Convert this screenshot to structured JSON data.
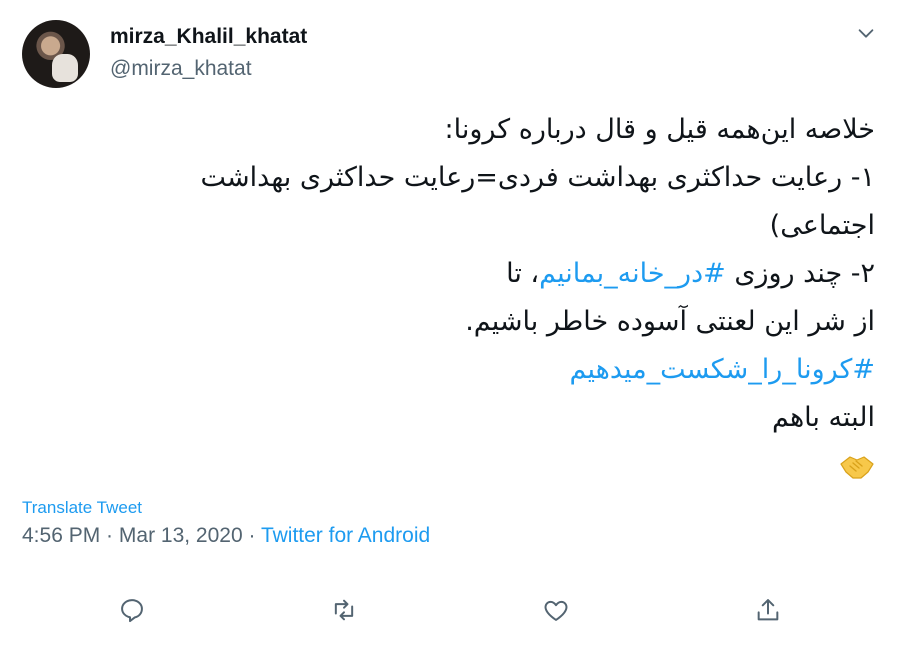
{
  "user": {
    "display_name": "mirza_Khalil_khatat",
    "handle": "@mirza_khatat"
  },
  "tweet": {
    "lines": [
      "خلاصه این‌همه قیل و قال درباره کرونا:",
      "۱- رعایت حداکثری بهداشت فردی=رعایت حداکثری بهداشت",
      "اجتماعی)"
    ],
    "line4_prefix": "۲- چند روزی ",
    "hashtag1": "#در_خانه_بمانیم",
    "line4_suffix": "، تا",
    "line5": "از شر این لعنتی آسوده خاطر باشیم.",
    "hashtag2": "#کرونا_را_شکست_میدهیم",
    "line7": "البته باهم",
    "emoji": "handshake-emoji"
  },
  "footer": {
    "translate_label": "Translate Tweet",
    "time": "4:56 PM",
    "separator": " · ",
    "date": "Mar 13, 2020",
    "source": "Twitter for Android"
  },
  "actions": [
    "reply-icon",
    "retweet-icon",
    "like-icon",
    "share-icon"
  ],
  "colors": {
    "accent": "#1d9bf0",
    "text": "#0f1419",
    "muted": "#536471",
    "emoji": "#f7c84a"
  }
}
